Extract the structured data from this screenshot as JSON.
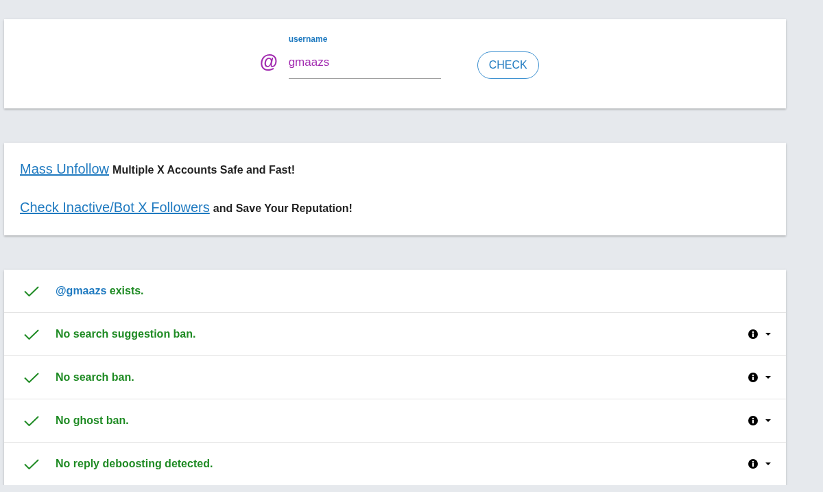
{
  "search": {
    "label": "username",
    "prefix": "@",
    "value": "gmaazs",
    "button": "CHECK"
  },
  "promos": [
    {
      "link": "Mass Unfollow",
      "text": "Multiple X Accounts Safe and Fast!"
    },
    {
      "link": "Check Inactive/Bot X Followers",
      "text": "and Save Your Reputation!"
    }
  ],
  "results": [
    {
      "kind": "exists",
      "handle": "@gmaazs",
      "text": "exists.",
      "passed": true
    },
    {
      "kind": "test",
      "text": "No search suggestion ban.",
      "passed": true,
      "expanded": false
    },
    {
      "kind": "test",
      "text": "No search ban.",
      "passed": true,
      "expanded": false
    },
    {
      "kind": "test",
      "text": "No ghost ban.",
      "passed": true,
      "expanded": false
    },
    {
      "kind": "test",
      "text": "No reply deboosting detected.",
      "passed": true,
      "expanded": false
    }
  ]
}
